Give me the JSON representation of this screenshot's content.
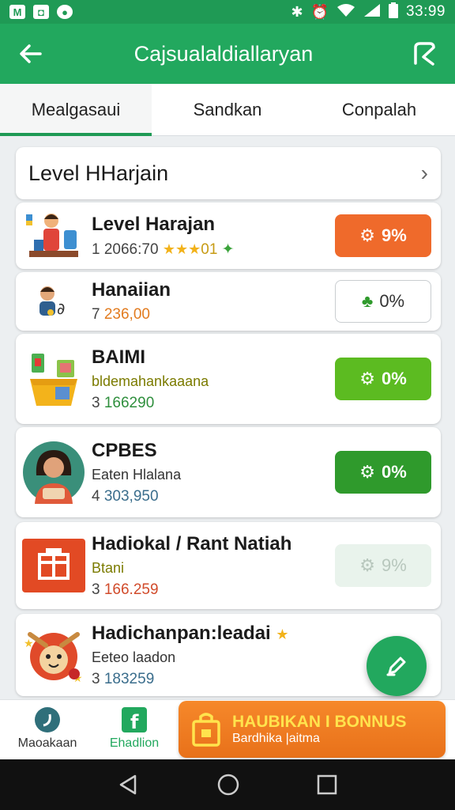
{
  "status_bar": {
    "time": "33:99"
  },
  "app_bar": {
    "title": "Cajsualaldiallaryan"
  },
  "tabs": [
    {
      "label": "Mealgasaui"
    },
    {
      "label": "Sandkan"
    },
    {
      "label": "Conpalah"
    }
  ],
  "section": {
    "title": "Level HHarjain"
  },
  "items": [
    {
      "name": "Level Harajan",
      "sub": "",
      "meta_prefix": "1",
      "meta_value": "2066:70",
      "stars": "★★★",
      "meta_suffix": "01",
      "percent": "9%"
    },
    {
      "name": "Hanaiian",
      "sub": "",
      "meta_prefix": "7",
      "meta_value": "236,00",
      "percent": "0%"
    },
    {
      "name": "BAIMI",
      "sub": "bldemahankaaana",
      "meta_prefix": "3",
      "meta_value": "166290",
      "percent": "0%"
    },
    {
      "name": "CPBES",
      "sub": "Eaten Hlalana",
      "meta_prefix": "4",
      "meta_value": "303,950",
      "percent": "0%"
    },
    {
      "name": "Hadiokal / Rant Natiah",
      "sub": "Btani",
      "meta_prefix": "3",
      "meta_value": "166.259",
      "percent": "9%"
    },
    {
      "name": "Hadichanpan:leadai",
      "sub": "Eeteo laadon",
      "meta_prefix": "3",
      "meta_value": "183259"
    }
  ],
  "bottom_nav": [
    {
      "label": "Maoakaan"
    },
    {
      "label": "Ehadlion"
    }
  ],
  "bonus": {
    "title": "HAUBIKAN I BONNUS",
    "subtitle": "Bardhika |aitma"
  },
  "colors": {
    "primary": "#22a85e",
    "orange": "#ef6a2b",
    "lime": "#5cbb21",
    "dark_green": "#2f9a2c"
  }
}
